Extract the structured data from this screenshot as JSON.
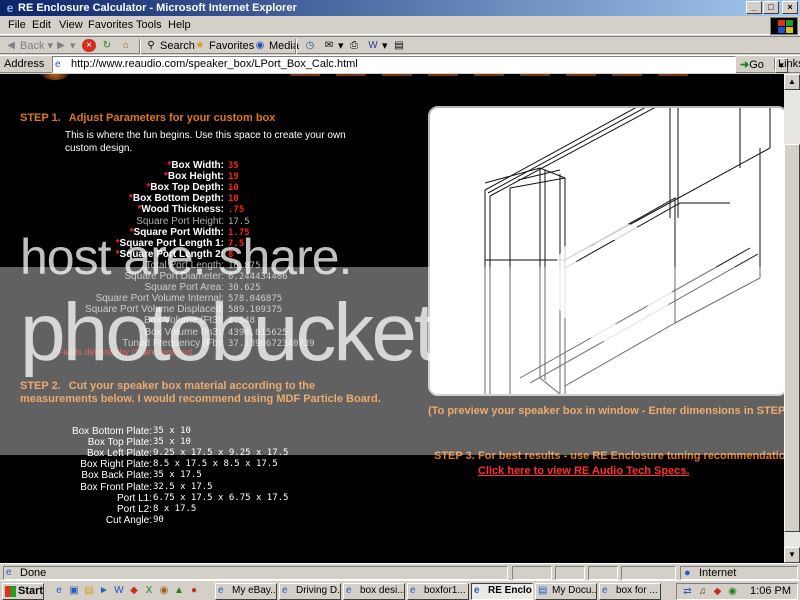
{
  "window": {
    "title": "RE Enclosure Calculator - Microsoft Internet Explorer",
    "buttons": [
      "_",
      "□",
      "×"
    ]
  },
  "menu": [
    "File",
    "Edit",
    "View",
    "Favorites",
    "Tools",
    "Help"
  ],
  "toolbar": {
    "back": "Back",
    "search": "Search",
    "favorites": "Favorites",
    "media": "Media"
  },
  "address": {
    "label": "Address",
    "url": "http://www.reaudio.com/speaker_box/LPort_Box_Calc.html",
    "go": "Go",
    "links": "Links"
  },
  "step1": {
    "number": "STEP 1.",
    "title": "Adjust Parameters for your custom box",
    "intro": "This is where the fun begins.  Use this space to create your own custom design."
  },
  "params": [
    {
      "label": "Box Width:",
      "value": "35",
      "required": true
    },
    {
      "label": "Box Height:",
      "value": "19",
      "required": true
    },
    {
      "label": "Box Top Depth:",
      "value": "10",
      "required": true
    },
    {
      "label": "Box Bottom Depth:",
      "value": "10",
      "required": true
    },
    {
      "label": "Wood Thickness:",
      "value": ".75",
      "required": true
    },
    {
      "label": "Square Port Height:",
      "value": "17.5",
      "required": false
    },
    {
      "label": "Square Port Width:",
      "value": "1.75",
      "required": true
    },
    {
      "label": "Square Port Length 1:",
      "value": "7.5",
      "required": true
    },
    {
      "label": "Square Port Length 2:",
      "value": "8",
      "required": true
    },
    {
      "label": "Total Port Length:",
      "value": "16.875",
      "required": false
    },
    {
      "label": "Square Port Diameter:",
      "value": "6.244434406",
      "required": false
    },
    {
      "label": "Square Port Area:",
      "value": "30.625",
      "required": false
    },
    {
      "label": "Square Port Volume Internal:",
      "value": "578.046875",
      "required": false
    },
    {
      "label": "Square Port Volume Displaced:",
      "value": "589.109375",
      "required": false
    },
    {
      "label": "Box Volume (Ft3):",
      "value": "2.548",
      "required": false
    },
    {
      "label": "Box Volume (In3):",
      "value": "4394.015625",
      "required": false
    },
    {
      "label": "Tuned Frequency (Fb):",
      "value": "37.1390672340739",
      "required": false
    }
  ],
  "required_note": "Fields denoted by (*) are required.",
  "step2": {
    "number": "STEP 2.",
    "text": "Cut your speaker box material according to the measurements below.  I would recommend using MDF Particle Board."
  },
  "cuts": [
    {
      "label": "Box Bottom Plate:",
      "value": "35 x 10"
    },
    {
      "label": "Box Top Plate:",
      "value": "35 x 10"
    },
    {
      "label": "Box Left Plate:",
      "value": "9.25 x 17.5 x 9.25 x 17.5"
    },
    {
      "label": "Box Right Plate:",
      "value": "8.5 x 17.5 x 8.5 x 17.5"
    },
    {
      "label": "Box Back Plate:",
      "value": "35 x 17.5"
    },
    {
      "label": "Box Front Plate:",
      "value": "32.5 x 17.5"
    },
    {
      "label": "Port L1:",
      "value": "6.75 x 17.5 x 6.75 x 17.5"
    },
    {
      "label": "Port L2:",
      "value": "8 x 17.5"
    },
    {
      "label": "Cut Angle:",
      "value": "90"
    }
  ],
  "preview": {
    "caption": "(To preview your speaker box in window - Enter dimensions in STEP 1"
  },
  "step3": {
    "number": "STEP 3.",
    "text": "For best results - use RE Enclosure tuning recommendations.",
    "link": "Click here to view RE Audio Tech Specs."
  },
  "watermark": {
    "line1": "host are. share.",
    "line2": "photobucket"
  },
  "status": {
    "text": "Done",
    "zone": "Internet"
  },
  "taskbar": {
    "start": "Start",
    "tasks": [
      {
        "label": "My eBay...",
        "active": false
      },
      {
        "label": "Driving D...",
        "active": false
      },
      {
        "label": "box desi...",
        "active": false
      },
      {
        "label": "boxfor1...",
        "active": false
      },
      {
        "label": "RE Enclo...",
        "active": true
      },
      {
        "label": "My Docu...",
        "active": false
      },
      {
        "label": "box for ...",
        "active": false
      }
    ],
    "clock": "1:06 PM"
  }
}
